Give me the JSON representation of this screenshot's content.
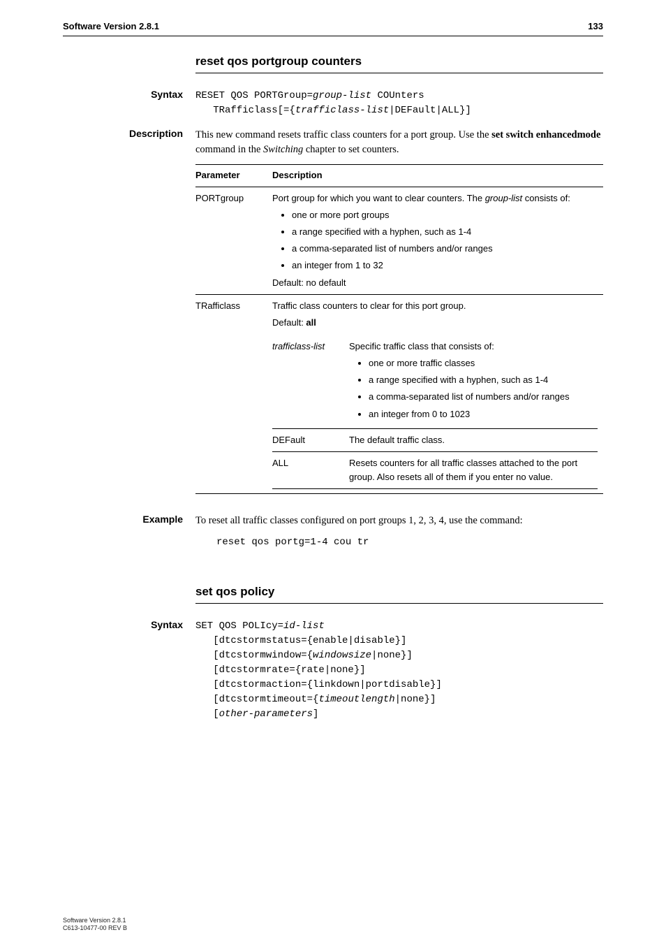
{
  "header": {
    "left": "Software Version 2.8.1",
    "right": "133"
  },
  "sec1": {
    "title": "reset qos portgroup counters",
    "syntax_label": "Syntax",
    "syntax_l1a": "RESET QOS PORTGroup=",
    "syntax_l1b": "group-list",
    "syntax_l1c": " COUnters",
    "syntax_l2a": "   TRafficlass[={",
    "syntax_l2b": "trafficlass-list",
    "syntax_l2c": "|DEFault|ALL}]",
    "desc_label": "Description",
    "desc_a": "This new command resets traffic class counters for a port group. Use the ",
    "desc_b": "set switch enhancedmode",
    "desc_c": " command in the ",
    "desc_d": "Switching",
    "desc_e": " chapter to set counters.",
    "th_param": "Parameter",
    "th_desc": "Description",
    "row1": {
      "name": "PORTgroup",
      "lead_a": "Port group for which you want to clear counters. The ",
      "lead_b": "group-list",
      "lead_c": " consists of:",
      "b1": "one or more port groups",
      "b2": "a range specified with a hyphen, such as 1-4",
      "b3": "a comma-separated list of numbers and/or ranges",
      "b4": "an integer from 1 to 32",
      "default": "Default: no default"
    },
    "row2": {
      "name": "TRafficlass",
      "lead": "Traffic class counters to clear for this port group.",
      "default_a": "Default: ",
      "default_b": "all",
      "sub1": {
        "name": "trafficlass-list",
        "lead": "Specific traffic class that consists of:",
        "b1": "one or more traffic classes",
        "b2": "a range specified with a hyphen, such as 1-4",
        "b3": "a comma-separated list of numbers and/or ranges",
        "b4": "an integer from 0 to 1023"
      },
      "sub2": {
        "name": "DEFault",
        "desc": "The default traffic class."
      },
      "sub3": {
        "name": "ALL",
        "desc": "Resets counters for all traffic classes attached to the port group. Also resets all of them if you enter no value."
      }
    },
    "example_label": "Example",
    "example_text": "To reset all traffic classes configured on port groups 1, 2, 3, 4, use the command:",
    "example_code": "reset qos portg=1-4 cou tr"
  },
  "sec2": {
    "title": "set qos policy",
    "syntax_label": "Syntax",
    "l1a": "SET QOS POLIcy=",
    "l1b": "id-list",
    "l2": "   [dtcstormstatus={enable|disable}]",
    "l3a": "   [dtcstormwindow={",
    "l3b": "windowsize",
    "l3c": "|none}]",
    "l4": "   [dtcstormrate={rate|none}]",
    "l5": "   [dtcstormaction={linkdown|portdisable}]",
    "l6a": "   [dtcstormtimeout={",
    "l6b": "timeoutlength",
    "l6c": "|none}]",
    "l7a": "   [",
    "l7b": "other-parameters",
    "l7c": "]"
  },
  "footer": {
    "l1": "Software Version 2.8.1",
    "l2": "C613-10477-00 REV B"
  }
}
